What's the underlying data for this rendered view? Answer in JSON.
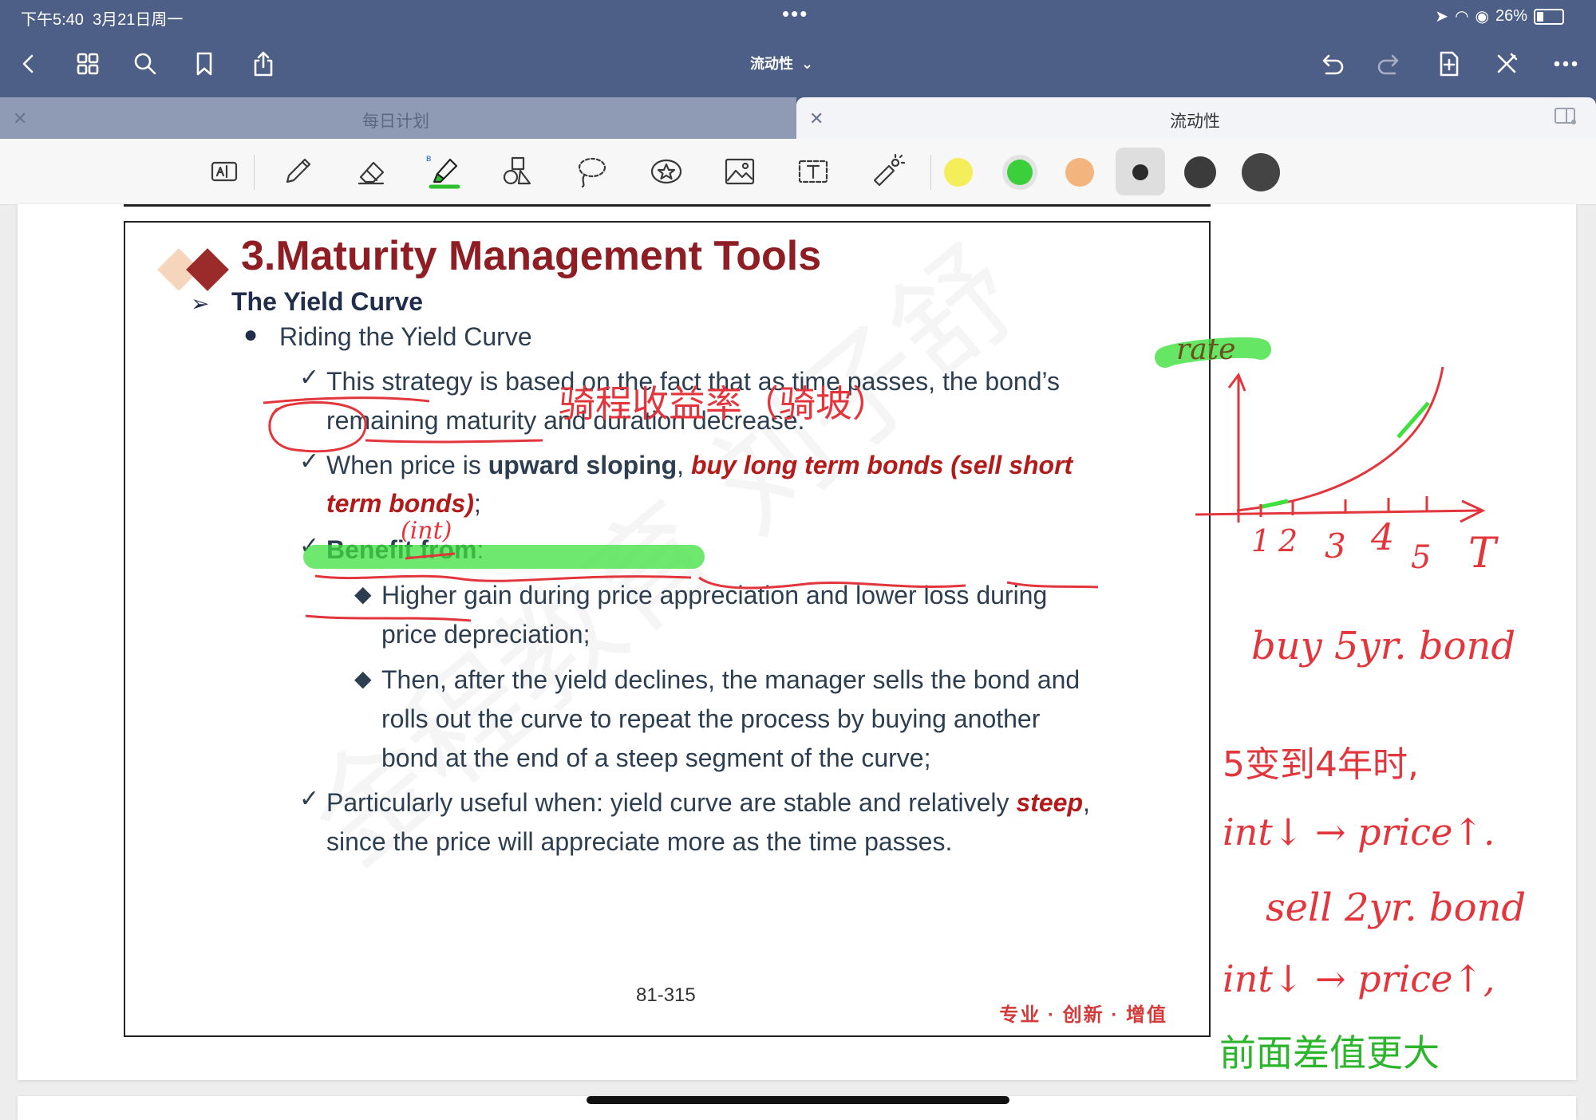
{
  "status_bar": {
    "time": "下午5:40",
    "date": "3月21日周一",
    "battery": "26%",
    "battery_level": 0.26
  },
  "nav": {
    "title": "流动性",
    "icons": [
      "back-icon",
      "grid-icon",
      "search-icon",
      "bookmark-icon",
      "share-icon",
      "undo-icon",
      "redo-icon",
      "add-page-icon",
      "close-x-icon",
      "more-icon"
    ]
  },
  "tabs": [
    {
      "label": "每日计划",
      "active": false
    },
    {
      "label": "流动性",
      "active": true
    }
  ],
  "toolbar": {
    "tools": [
      "page-layout-icon",
      "pen-icon",
      "eraser-icon",
      "highlighter-icon",
      "shapes-icon",
      "lasso-icon",
      "sticker-icon",
      "image-icon",
      "text-box-icon",
      "laser-pointer-icon"
    ],
    "colors": [
      "#f4ee5a",
      "#3ccf3c",
      "#f3b47e",
      "#2b2b2b",
      "#3b3b3b",
      "#444444"
    ],
    "selected_color": "#3ccf3c"
  },
  "slide": {
    "title": "3.Maturity Management Tools",
    "section": "The Yield Curve",
    "bullet": "Riding the Yield Curve",
    "points": {
      "p1_line1": "This strategy is based on the fact that as time passes, the bond’s",
      "p1_line2": "remaining maturity and duration decrease.",
      "p2_a": "When price is ",
      "p2_b": "upward sloping",
      "p2_c": ", ",
      "p2_d": "buy long term bonds (sell short",
      "p2_line2": "term bonds)",
      "p2_line2_end": ";",
      "p3": "Benefit from",
      "p3_end": ":",
      "sub1_line1": "Higher gain during price appreciation and lower loss during",
      "sub1_line2": "price depreciation;",
      "sub2_line1": "Then, after the yield declines, the manager sells the bond and",
      "sub2_line2": "rolls out the curve to repeat the process by buying another",
      "sub2_line3": "bond at the end of a steep segment of the curve;",
      "p4_a": "Particularly useful when: yield curve are stable and relatively ",
      "p4_b": "steep",
      "p4_c": ",",
      "p4_line2": "since the price will appreciate more as the time passes."
    },
    "page_number": "81-315",
    "footer": "专业 · 创新 · 增值",
    "watermark": "金程教育 刘子舒"
  },
  "annotations": {
    "riding_note": "骑程收益率（骑坡）",
    "int_note": "(int)",
    "graph_y_label": "rate",
    "graph_x_label": "T",
    "graph_ticks": [
      "1",
      "2",
      "3",
      "4",
      "5"
    ],
    "note1": "buy 5yr. bond",
    "note2": "5变到4年时,",
    "note3": "int↓ → price↑.",
    "note4": "sell 2yr. bond",
    "note5": "int↓ → price↑,",
    "note6": "前面差值更大"
  }
}
